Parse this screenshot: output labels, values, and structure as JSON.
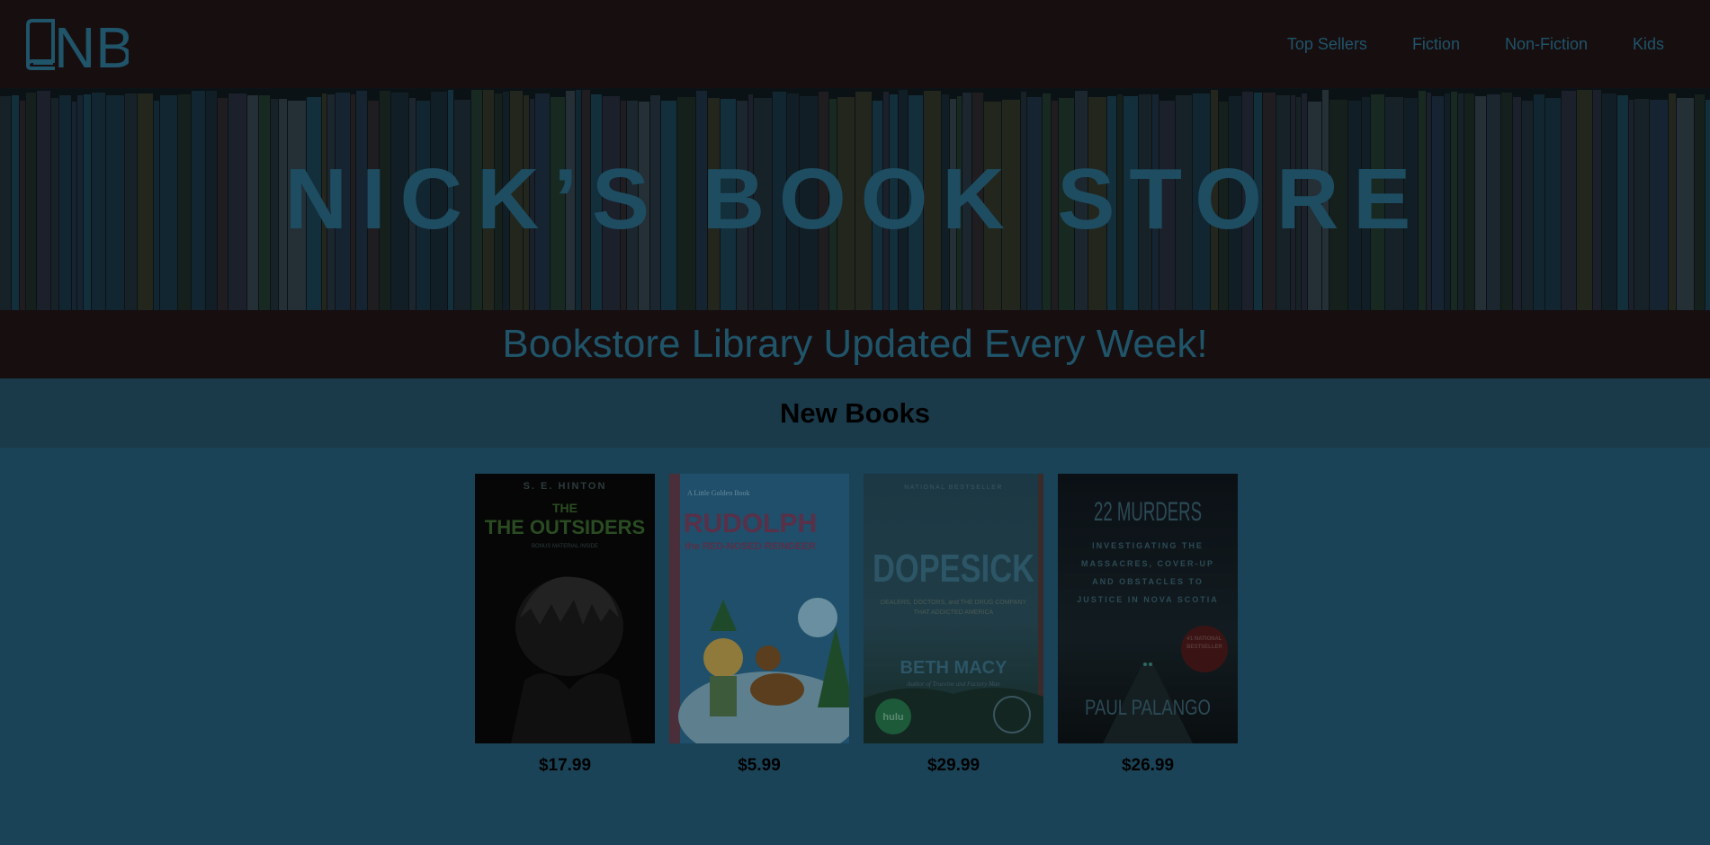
{
  "header": {
    "logo_text": "NB",
    "nav": [
      {
        "label": "Top Sellers"
      },
      {
        "label": "Fiction"
      },
      {
        "label": "Non-Fiction"
      },
      {
        "label": "Kids"
      }
    ]
  },
  "hero": {
    "title": "NICK’S BOOK STORE"
  },
  "banner": {
    "tagline": "Bookstore Library Updated Every Week!"
  },
  "new_books": {
    "heading": "New Books",
    "items": [
      {
        "author": "S. E. HINTON",
        "title": "THE OUTSIDERS",
        "subtitle": "BONUS MATERIAL INSIDE",
        "price": "$17.99"
      },
      {
        "series": "A Little Golden Book",
        "title": "RUDOLPH",
        "subtitle": "the RED-NOSED REINDEER",
        "price": "$5.99"
      },
      {
        "kicker": "NATIONAL BESTSELLER",
        "title": "DOPESICK",
        "subtitle": "DEALERS, DOCTORS, and THE DRUG COMPANY THAT ADDICTED AMERICA",
        "author": "BETH MACY",
        "author_note": "Author of Truevine and Factory Man",
        "badge": "hulu",
        "price": "$29.99"
      },
      {
        "title": "22 MURDERS",
        "subtitle": "INVESTIGATING THE MASSACRES, COVER-UP AND OBSTACLES TO JUSTICE IN NOVA SCOTIA",
        "badge": "#1 NATIONAL BESTSELLER",
        "author": "PAUL PALANGO",
        "price": "$26.99"
      }
    ]
  },
  "colors": {
    "header_bg": "#170e10",
    "accent_text": "#1f5469",
    "page_bg": "#1a4357",
    "section_head_bg": "#1b3a49"
  }
}
